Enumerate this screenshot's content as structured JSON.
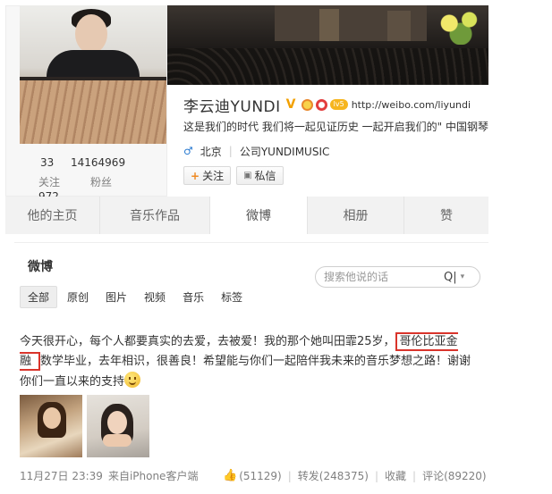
{
  "profile": {
    "name": "李云迪YUNDI",
    "url": "http://weibo.com/liyundi",
    "bio": "这是我们的时代 我们将一起见证历史 一起开启我们的\" 中国钢琴",
    "location": "北京",
    "company": "公司YUNDIMUSIC",
    "gender_icon": "♂",
    "vip_label": "lv5",
    "stats": {
      "following": "33",
      "following_label": "关注",
      "followers": "14164969",
      "followers_label": "粉丝",
      "posts": "972"
    },
    "follow_button": "关注",
    "message_button": "私信"
  },
  "tabs": [
    "他的主页",
    "音乐作品",
    "微博",
    "相册",
    "赞"
  ],
  "feed": {
    "title": "微博",
    "search_placeholder": "搜索他说的话",
    "filters": [
      "全部",
      "原创",
      "图片",
      "视频",
      "音乐",
      "标签"
    ]
  },
  "post": {
    "text_before": "今天很开心，每个人都要真实的去爱，去被爱！我的那个她叫田霏25岁，",
    "text_highlight": "哥伦比亚金融",
    "text_after": "数学毕业，去年相识，很善良！希望能与你们一起陪伴我未来的音乐梦想之路！谢谢你们一直以来的支持",
    "time": "11月27日 23:39",
    "source": "来自iPhone客户端",
    "likes": "(51129)",
    "repost": "转发(248375)",
    "favorite": "收藏",
    "comment": "评论(89220)"
  },
  "colors": {
    "highlight_border": "#d9342b",
    "tab_bg": "#f2f2f2",
    "badge_gold": "#f6b51e",
    "link_blue": "#2b7bd1"
  }
}
